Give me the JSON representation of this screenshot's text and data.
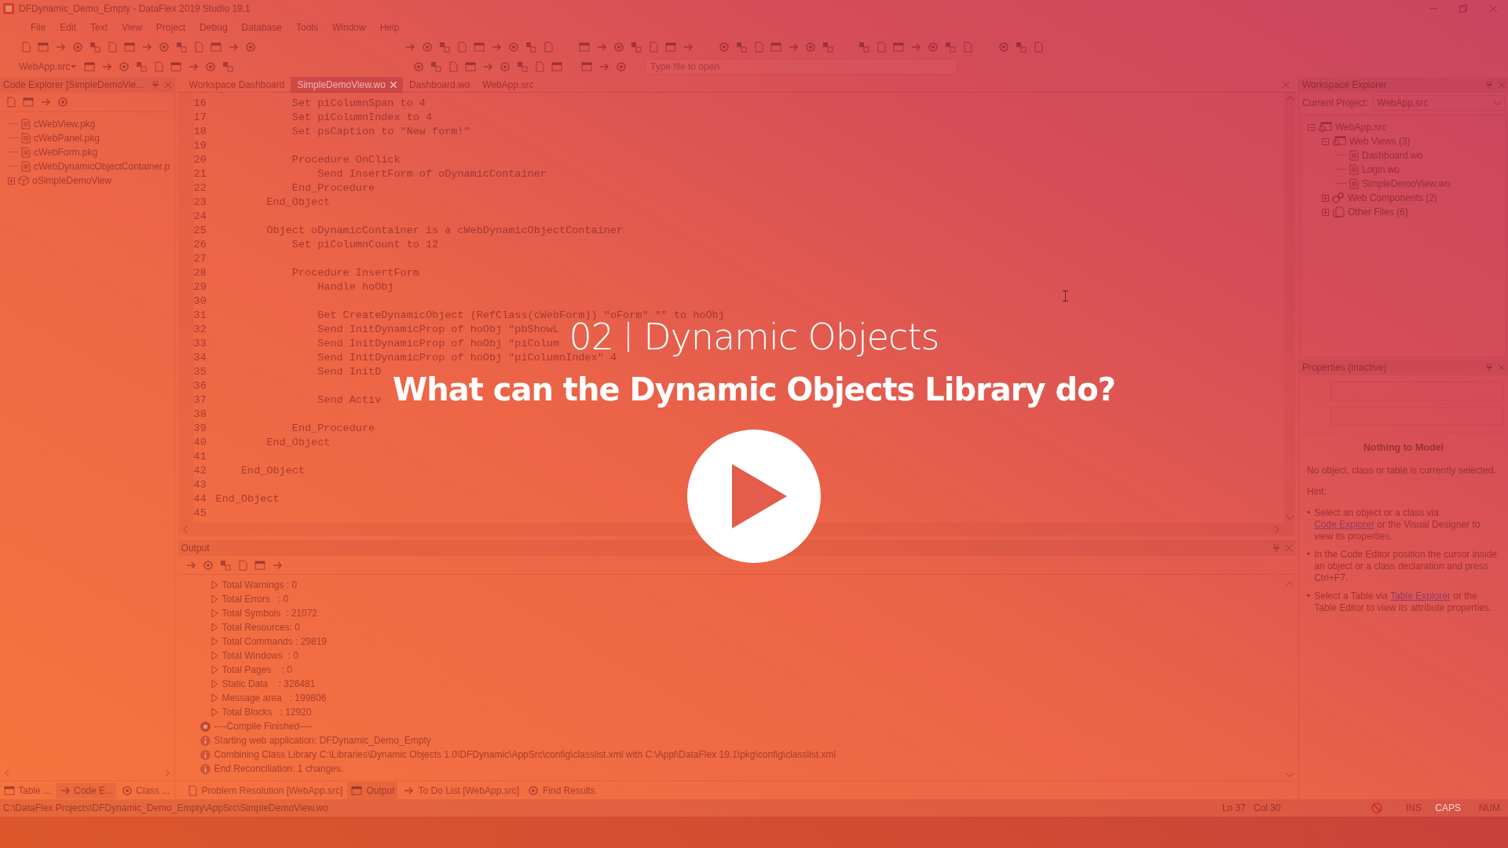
{
  "window": {
    "title": "DFDynamic_Demo_Empty - DataFlex 2019 Studio 19.1"
  },
  "menu": [
    "File",
    "Edit",
    "Text",
    "View",
    "Project",
    "Debug",
    "Database",
    "Tools",
    "Window",
    "Help"
  ],
  "toolbar": {
    "project_combo": "WebApp.src",
    "open_file": {
      "placeholder": "Type file to open"
    }
  },
  "code_explorer": {
    "title": "Code Explorer [SimpleDemoVie...",
    "items": [
      {
        "label": "cWebView.pkg",
        "kind": "file"
      },
      {
        "label": "cWebPanel.pkg",
        "kind": "file"
      },
      {
        "label": "cWebForm.pkg",
        "kind": "file"
      },
      {
        "label": "cWebDynamicObjectContainer.p",
        "kind": "file"
      },
      {
        "label": "oSimpleDemoView",
        "kind": "object",
        "expanded": false
      }
    ],
    "tabs": [
      {
        "label": "Table ...",
        "selected": false
      },
      {
        "label": "Code E...",
        "selected": true
      },
      {
        "label": "Class ...",
        "selected": false
      }
    ]
  },
  "editor": {
    "tabs": [
      {
        "label": "Workspace Dashboard",
        "selected": false
      },
      {
        "label": "SimpleDemoView.wo",
        "selected": true
      },
      {
        "label": "Dashboard.wo",
        "selected": false
      },
      {
        "label": "WebApp.src",
        "selected": false
      }
    ],
    "lines": [
      {
        "number": "16",
        "code": "            Set piColumnSpan to 4"
      },
      {
        "number": "17",
        "code": "            Set piColumnIndex to 4"
      },
      {
        "number": "18",
        "code": "            Set psCaption to \"New form!\""
      },
      {
        "number": "19"
      },
      {
        "number": "20",
        "code": "            Procedure OnClick"
      },
      {
        "number": "21",
        "code": "                Send InsertForm of oDynamicContainer"
      },
      {
        "number": "22",
        "code": "            End_Procedure"
      },
      {
        "number": "23",
        "code": "        End_Object"
      },
      {
        "number": "24"
      },
      {
        "number": "25",
        "code": "        Object oDynamicContainer is a cWebDynamicObjectContainer"
      },
      {
        "number": "26",
        "code": "            Set piColumnCount to 12"
      },
      {
        "number": "27"
      },
      {
        "number": "28",
        "code": "            Procedure InsertForm"
      },
      {
        "number": "29",
        "code": "                Handle hoObj"
      },
      {
        "number": "30"
      },
      {
        "number": "31",
        "code": "                Get CreateDynamicObject (RefClass(cWebForm)) \"oForm\" \"\" to hoObj"
      },
      {
        "number": "32",
        "code": "                Send InitDynamicProp of hoObj \"pbShowL"
      },
      {
        "number": "33",
        "code": "                Send InitDynamicProp of hoObj \"piColum"
      },
      {
        "number": "34",
        "code": "                Send InitDynamicProp of hoObj \"piColumnIndex\" 4"
      },
      {
        "number": "35",
        "code": "                Send InitD"
      },
      {
        "number": "36"
      },
      {
        "number": "37",
        "code": "                Send Activ"
      },
      {
        "number": "38"
      },
      {
        "number": "39",
        "code": "            End_Procedure"
      },
      {
        "number": "40",
        "code": "        End_Object"
      },
      {
        "number": "41"
      },
      {
        "number": "42",
        "code": "    End_Object"
      },
      {
        "number": "43"
      },
      {
        "number": "44",
        "code": "End_Object"
      },
      {
        "number": "45"
      }
    ]
  },
  "output": {
    "title": "Output",
    "lines": [
      {
        "kind": "stat",
        "text": "Total Warnings : 0"
      },
      {
        "kind": "stat",
        "text": "Total Errors   : 0"
      },
      {
        "kind": "stat",
        "text": "Total Symbols  : 21072"
      },
      {
        "kind": "stat",
        "text": "Total Resources: 0"
      },
      {
        "kind": "stat",
        "text": "Total Commands : 29819"
      },
      {
        "kind": "stat",
        "text": "Total Windows  : 0"
      },
      {
        "kind": "stat",
        "text": "Total Pages    : 0"
      },
      {
        "kind": "stat",
        "text": "Static Data    : 326481"
      },
      {
        "kind": "stat",
        "text": "Message area   : 199806"
      },
      {
        "kind": "stat",
        "text": "Total Blocks   : 12920"
      },
      {
        "kind": "stop",
        "text": "----Compile Finished----"
      },
      {
        "kind": "info",
        "text": "Starting web application: DFDynamic_Demo_Empty"
      },
      {
        "kind": "info",
        "text": "Combining Class Library C:\\Libraries\\Dynamic Objects 1.0\\DFDynamic\\AppSrc\\config\\classlist.xml with C:\\Appl\\DataFlex 19.1\\pkg\\config\\classlist.xml"
      },
      {
        "kind": "info",
        "text": "End Reconciliation: 1 changes."
      }
    ],
    "tabs": [
      {
        "label": "Problem Resolution [WebApp.src]",
        "selected": false
      },
      {
        "label": "Output",
        "selected": true
      },
      {
        "label": "To Do List [WebApp.src]",
        "selected": false
      },
      {
        "label": "Find Results",
        "selected": false
      }
    ]
  },
  "workspace_explorer": {
    "title": "Workspace Explorer",
    "project_label": "Current Project:",
    "project": "WebApp.src",
    "tree": [
      {
        "label": "WebApp.src",
        "kind": "project",
        "expanded": true,
        "children": [
          {
            "label": "Web Views (3)",
            "kind": "views",
            "expanded": true,
            "children": [
              {
                "label": "Dashboard.wo",
                "kind": "file"
              },
              {
                "label": "Login.wo",
                "kind": "file"
              },
              {
                "label": "SimpleDemoView.wo",
                "kind": "file"
              }
            ]
          },
          {
            "label": "Web Components (2)",
            "kind": "components",
            "expanded": false
          },
          {
            "label": "Other Files (6)",
            "kind": "files",
            "expanded": false
          }
        ]
      }
    ]
  },
  "properties": {
    "title": "Properties (Inactive)",
    "heading": "Nothing to Model",
    "message": "No object, class or table is currently selected.",
    "hint_label": "Hint:",
    "hints": [
      {
        "bullet": "•",
        "text": "Select an object or a class via ",
        "link": "Code Explorer",
        "after": " or the Visual Designer to view its properties."
      },
      {
        "bullet": "•",
        "text": "In the Code Editor position the cursor inside an object or a class declaration and press Ctrl+F7."
      },
      {
        "bullet": "•",
        "text": "Select a Table via ",
        "link": "Table Explorer",
        "after": " or the Table Editor to view its attribute properties."
      }
    ]
  },
  "status_bar": {
    "path": "C:\\DataFlex Projects\\DFDynamic_Demo_Empty\\AppSrc\\SimpleDemoView.wo",
    "line": "Ln 37",
    "column": "Col 30",
    "indicators": [
      {
        "label": "INS",
        "on": true
      },
      {
        "label": "CAPS",
        "on": false
      },
      {
        "label": "NUM",
        "on": true
      }
    ]
  },
  "video": {
    "number": "02",
    "title": "Dynamic Objects",
    "subtitle": "What can the Dynamic Objects Library do?"
  }
}
